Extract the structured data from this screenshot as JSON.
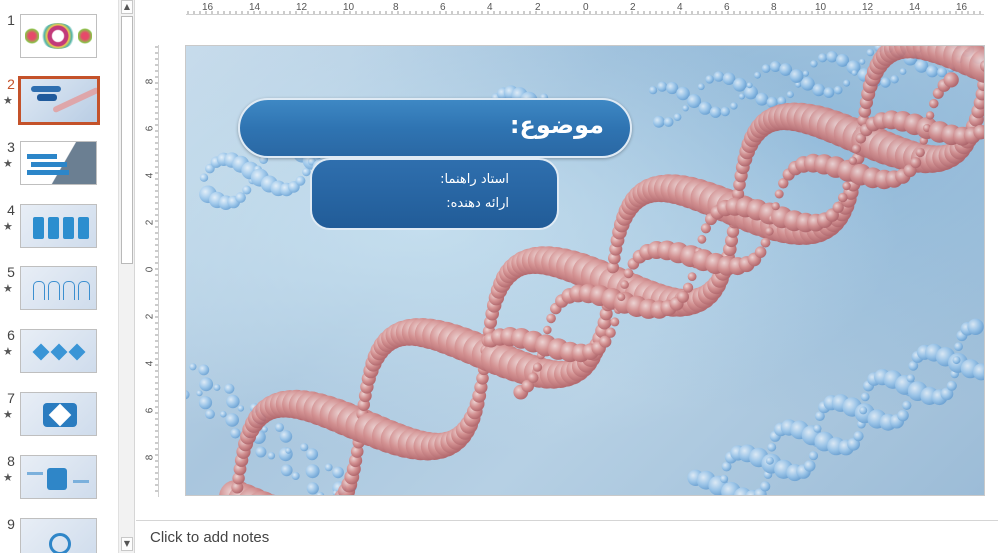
{
  "thumbnails": [
    {
      "number": "1",
      "starred": false,
      "selected": false
    },
    {
      "number": "2",
      "starred": true,
      "selected": true
    },
    {
      "number": "3",
      "starred": true,
      "selected": false
    },
    {
      "number": "4",
      "starred": true,
      "selected": false
    },
    {
      "number": "5",
      "starred": true,
      "selected": false
    },
    {
      "number": "6",
      "starred": true,
      "selected": false
    },
    {
      "number": "7",
      "starred": true,
      "selected": false
    },
    {
      "number": "8",
      "starred": true,
      "selected": false
    },
    {
      "number": "9",
      "starred": false,
      "selected": false
    }
  ],
  "star_glyph": "★",
  "ruler": {
    "horizontal": [
      "16",
      "14",
      "12",
      "10",
      "8",
      "6",
      "4",
      "2",
      "0",
      "2",
      "4",
      "6",
      "8",
      "10",
      "12",
      "14",
      "16"
    ],
    "vertical": [
      "8",
      "6",
      "4",
      "2",
      "0",
      "2",
      "4",
      "6",
      "8"
    ]
  },
  "slide": {
    "title": "موضوع:",
    "advisor_label": "استاد راهنما:",
    "presenter_label": "ارائه دهنده:"
  },
  "notes": {
    "placeholder": "Click to add notes"
  },
  "colors": {
    "selection_accent": "#c4522a",
    "title_box": "#2f74b2",
    "info_box": "#215c98"
  }
}
